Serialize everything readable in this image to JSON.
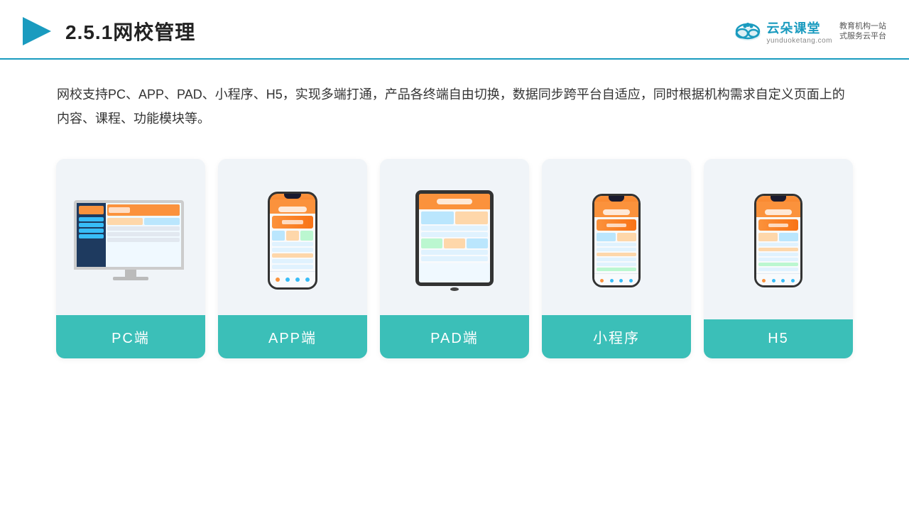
{
  "header": {
    "section_number": "2.5.1",
    "title": "网校管理",
    "brand": {
      "name": "云朵课堂",
      "url": "yunduoketang.com",
      "tagline_line1": "教育机构一站",
      "tagline_line2": "式服务云平台"
    }
  },
  "description": {
    "text": "网校支持PC、APP、PAD、小程序、H5，实现多端打通，产品各终端自由切换，数据同步跨平台自适应，同时根据机构需求自定义页面上的内容、课程、功能模块等。"
  },
  "cards": [
    {
      "id": "pc",
      "label": "PC端"
    },
    {
      "id": "app",
      "label": "APP端"
    },
    {
      "id": "pad",
      "label": "PAD端"
    },
    {
      "id": "miniprogram",
      "label": "小程序"
    },
    {
      "id": "h5",
      "label": "H5"
    }
  ],
  "colors": {
    "accent": "#3bbfb8",
    "header_line": "#1a9bbf",
    "card_bg": "#f0f4f8",
    "text_main": "#333333",
    "brand_color": "#1a9bbf"
  }
}
